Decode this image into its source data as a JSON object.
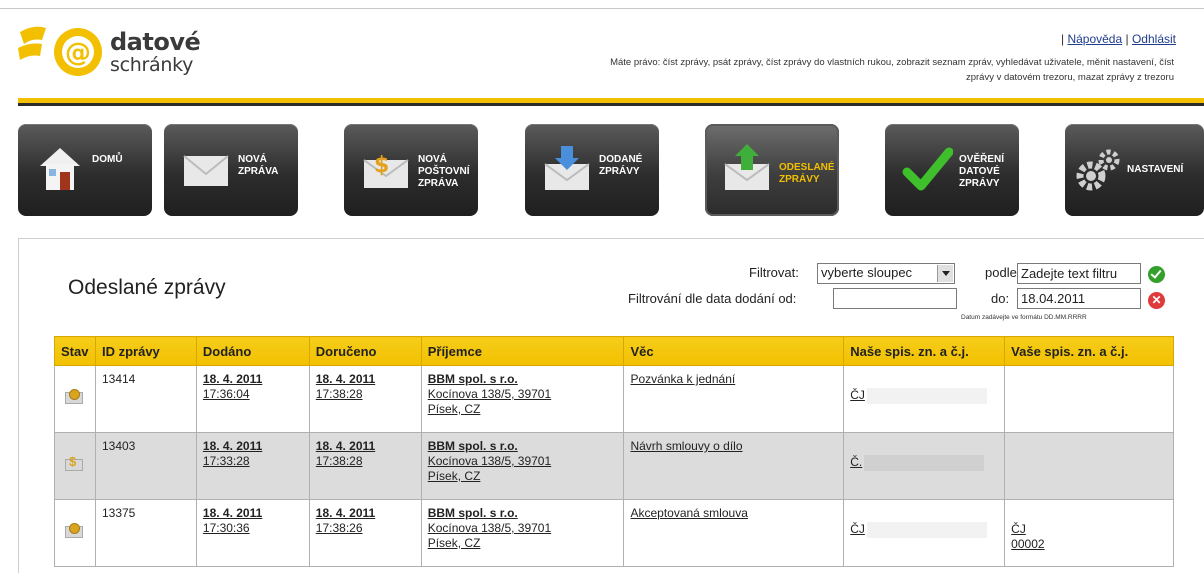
{
  "logo": {
    "line1": "datové",
    "line2": "schránky",
    "symbol": "@"
  },
  "header": {
    "help": "Nápověda",
    "logout": "Odhlásit",
    "separator": "|",
    "rights_line1": "Máte právo: číst zprávy, psát zprávy, číst zprávy do vlastních rukou, zobrazit seznam zpráv, vyhledávat uživatele, měnit nastavení, číst",
    "rights_line2": "zprávy v datovém trezoru, mazat zprávy z trezoru"
  },
  "nav": [
    {
      "label": "DOMŮ",
      "icon": "home-icon"
    },
    {
      "label": "NOVÁ\nZPRÁVA",
      "icon": "envelope-icon"
    },
    {
      "label": "NOVÁ\nPOŠTOVNÍ\nZPRÁVA",
      "icon": "postal-envelope-icon"
    },
    {
      "label": "DODANÉ\nZPRÁVY",
      "icon": "inbox-icon"
    },
    {
      "label": "ODESLANÉ\nZPRÁVY",
      "icon": "outbox-icon",
      "active": true
    },
    {
      "label": "OVĚŘENÍ\nDATOVÉ\nZPRÁVY",
      "icon": "checkmark-icon"
    },
    {
      "label": "NASTAVENÍ",
      "icon": "gears-icon"
    }
  ],
  "page": {
    "title": "Odeslané zprávy"
  },
  "filter": {
    "label": "Filtrovat:",
    "select_value": "vyberte sloupec",
    "by_label": "podle:",
    "text_value": "Zadejte text filtru",
    "date_label": "Filtrování dle data dodání od:",
    "date_from_value": "",
    "to_label": "do:",
    "date_to_value": "18.04.2011",
    "date_hint": "Datum zadávejte ve formátu DD.MM.RRRR",
    "x_symbol": "✕"
  },
  "table": {
    "columns": [
      "Stav",
      "ID zprávy",
      "Dodáno",
      "Doručeno",
      "Příjemce",
      "Věc",
      "Naše spis. zn. a č.j.",
      "Vaše spis. zn. a č.j."
    ],
    "rows": [
      {
        "id": "13414",
        "dodano_date": "18. 4. 2011",
        "dodano_time": "17:36:04",
        "doruceno_date": "18. 4. 2011",
        "doruceno_time": "17:38:28",
        "recipient_name": "BBM spol. s r.o.",
        "recipient_addr1": "Kocínova 138/5, 39701",
        "recipient_addr2": "Písek, CZ",
        "subject": "Pozvánka k jednání",
        "our_ref": "ČJ",
        "your_ref1": "",
        "your_ref2": "",
        "status": "sealed-envelope-icon"
      },
      {
        "id": "13403",
        "dodano_date": "18. 4. 2011",
        "dodano_time": "17:33:28",
        "doruceno_date": "18. 4. 2011",
        "doruceno_time": "17:38:28",
        "recipient_name": "BBM spol. s r.o.",
        "recipient_addr1": "Kocínova 138/5, 39701",
        "recipient_addr2": "Písek, CZ",
        "subject": "Návrh smlouvy o dílo",
        "our_ref": "Č.",
        "your_ref1": "",
        "your_ref2": "",
        "status": "paid-envelope-icon"
      },
      {
        "id": "13375",
        "dodano_date": "18. 4. 2011",
        "dodano_time": "17:30:36",
        "doruceno_date": "18. 4. 2011",
        "doruceno_time": "17:38:26",
        "recipient_name": "BBM spol. s r.o.",
        "recipient_addr1": "Kocínova 138/5, 39701",
        "recipient_addr2": "Písek, CZ",
        "subject": "Akceptovaná smlouva",
        "our_ref": "ČJ",
        "your_ref1": "ČJ",
        "your_ref2": "00002",
        "status": "sealed-envelope-icon"
      }
    ]
  }
}
